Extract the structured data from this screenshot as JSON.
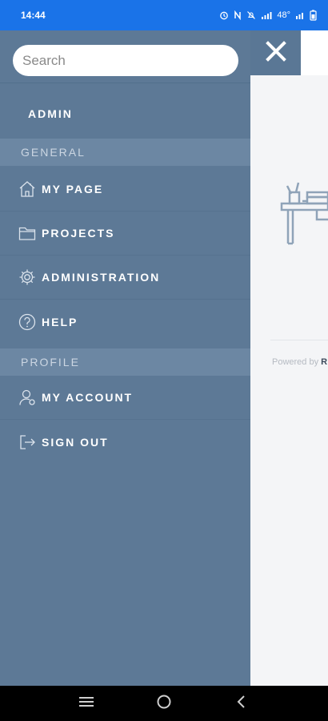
{
  "status_bar": {
    "time": "14:44",
    "battery_text": "48°",
    "icons": [
      "alarm-icon",
      "nfc-icon",
      "mute-icon",
      "signal-icon",
      "wifi-signal-icon",
      "battery-icon"
    ]
  },
  "drawer": {
    "search": {
      "placeholder": "Search",
      "value": ""
    },
    "user_label": "ADMIN",
    "sections": [
      {
        "header": "GENERAL",
        "items": [
          {
            "label": "MY PAGE",
            "icon": "home-icon"
          },
          {
            "label": "PROJECTS",
            "icon": "folder-icon"
          },
          {
            "label": "ADMINISTRATION",
            "icon": "gear-icon"
          },
          {
            "label": "HELP",
            "icon": "help-icon"
          }
        ]
      },
      {
        "header": "PROFILE",
        "items": [
          {
            "label": "MY ACCOUNT",
            "icon": "user-icon"
          },
          {
            "label": "SIGN OUT",
            "icon": "sign-out-icon"
          }
        ]
      }
    ]
  },
  "background_page": {
    "close_icon": "close-icon",
    "illustration": "desk-icon",
    "footer_text": "Powered by",
    "footer_brand": "R"
  },
  "nav_bar": {
    "buttons": [
      "recents-icon",
      "home-circle-icon",
      "back-icon"
    ]
  },
  "colors": {
    "status_bar": "#1a73e8",
    "drawer": "#5d7996",
    "section_header": "#6c87a3"
  }
}
